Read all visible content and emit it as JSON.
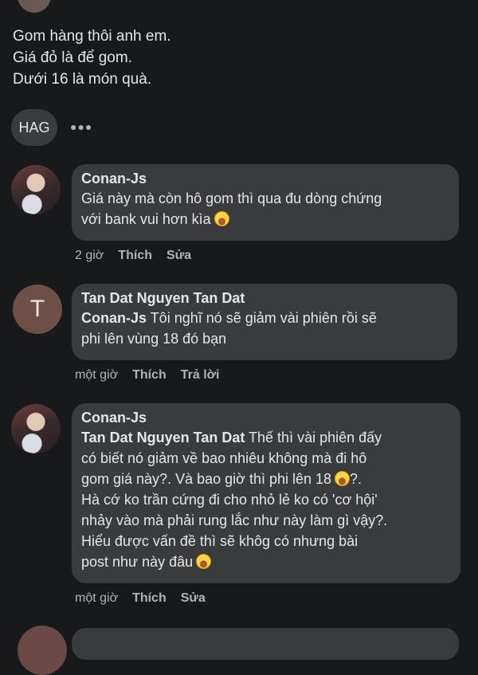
{
  "post": {
    "lines": [
      "Gom hàng thôi anh em.",
      "Giá đỏ là để gom.",
      "Dưới 16 là món quà."
    ]
  },
  "tag": {
    "label": "HAG"
  },
  "more_icon": "more-horizontal-icon",
  "comments": [
    {
      "author": "Conan-Js",
      "avatar": "photo",
      "lines": [
        "Giá này mà còn hô gom thì qua đu dòng chứng",
        "với bank vui hơn kìa"
      ],
      "time": "2 giờ",
      "actions": [
        "Thích",
        "Sửa"
      ]
    },
    {
      "author": "Tan Dat Nguyen Tan Dat",
      "avatar_letter": "T",
      "mention": "Conan-Js",
      "lines": [
        " Tôi nghĩ nó sẽ giảm vài phiên rồi sẽ",
        "phi lên vùng 18 đó bạn"
      ],
      "time": "một giờ",
      "actions": [
        "Thích",
        "Trả lời"
      ]
    },
    {
      "author": "Conan-Js",
      "avatar": "photo",
      "mention": "Tan Dat Nguyen Tan Dat",
      "lines": [
        " Thế thì vài phiên đấy",
        "có biết nó giảm về bao nhiêu không mà đi hô",
        "gom giá này?. Và bao giờ thì phi lên 18",
        "?.",
        "Hà cớ ko trần cứng đi cho nhỏ lẻ ko có 'cơ hội'",
        "nhảy vào mà phải rung lắc như này làm gì vậy?.",
        "Hiểu được vấn đề thì sẽ khôg có nhưng bài",
        "post như này đâu"
      ],
      "time": "một giờ",
      "actions": [
        "Thích",
        "Sửa"
      ]
    }
  ],
  "colors": {
    "background": "#18191a",
    "bubble": "#3a3b3c",
    "text": "#e4e6eb",
    "meta": "#b0b3b8"
  }
}
